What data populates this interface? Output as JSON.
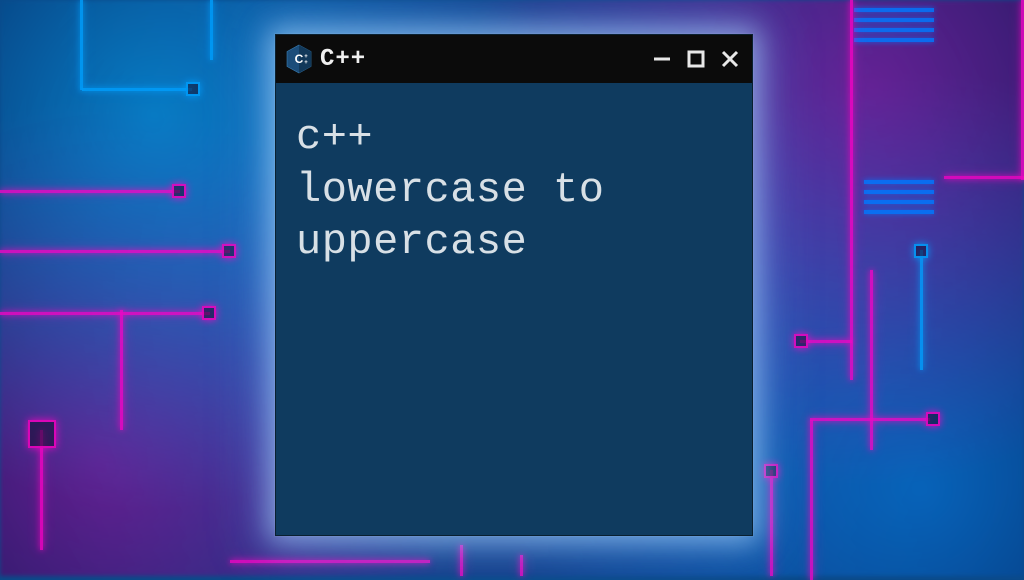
{
  "window": {
    "title": "C++",
    "content": "c++\nlowercase to\nuppercase",
    "icon_name": "cpp-logo"
  },
  "controls": {
    "minimize": "−",
    "maximize": "□",
    "close": "×"
  },
  "colors": {
    "window_bg": "#0f3b5f",
    "titlebar_bg": "#0b0b0b",
    "text": "#d8e0e6",
    "neon_magenta": "#ff00c8",
    "neon_blue": "#00a0ff"
  }
}
